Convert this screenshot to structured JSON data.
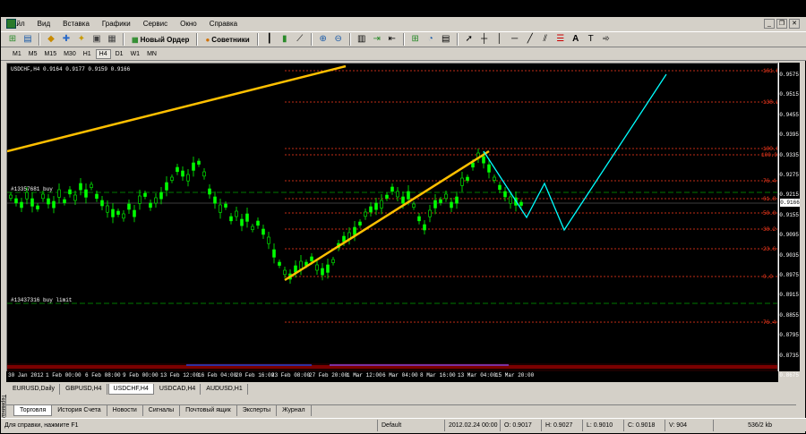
{
  "menu": {
    "items": [
      "Файл",
      "Вид",
      "Вставка",
      "Графики",
      "Сервис",
      "Окно",
      "Справка"
    ]
  },
  "toolbar": {
    "new_order_label": "Новый Ордер",
    "advisors_label": "Советники",
    "icons": [
      "new-chart-icon",
      "profiles-icon",
      "market-watch-icon",
      "data-window-icon",
      "navigator-icon",
      "terminal-icon",
      "tester-icon",
      "new-order-icon",
      "advisors-icon",
      "bar-chart-icon",
      "candle-chart-icon",
      "line-chart-icon",
      "zoom-in-icon",
      "zoom-out-icon",
      "tile-icon",
      "autoscroll-icon",
      "chart-shift-icon",
      "indicators-icon",
      "periods-icon",
      "templates-icon",
      "cursor-icon",
      "crosshair-icon",
      "vertical-line-icon",
      "horizontal-line-icon",
      "trendline-icon",
      "channel-icon",
      "fibonacci-icon",
      "text-icon",
      "label-icon",
      "arrows-icon"
    ]
  },
  "timeframes": [
    "M1",
    "M5",
    "M15",
    "M30",
    "H1",
    "H4",
    "D1",
    "W1",
    "MN"
  ],
  "active_timeframe": "H4",
  "chart": {
    "symbol_info": "USDCHF,H4  0.9164 0.9177 0.9159 0.9166",
    "order_buy_label": "#13357681 buy",
    "order_buy_limit_label": "#13437316 buy limit",
    "current_price": "0.9166",
    "price_ticks": [
      "0.9575",
      "0.9515",
      "0.9455",
      "0.9395",
      "0.9335",
      "0.9275",
      "0.9215",
      "0.9155",
      "0.9095",
      "0.9035",
      "0.8975",
      "0.8915",
      "0.8855",
      "0.8795",
      "0.8735",
      "0.8675"
    ],
    "time_ticks": [
      "30 Jan 2012",
      "1 Feb 00:00",
      "6 Feb 08:00",
      "9 Feb 00:00",
      "13 Feb 12:00",
      "16 Feb 04:00",
      "20 Feb 16:00",
      "23 Feb 08:00",
      "27 Feb 20:00",
      "1 Mar 12:00",
      "6 Mar 04:00",
      "8 Mar 16:00",
      "13 Mar 04:00",
      "15 Mar 20:00"
    ],
    "fib_levels": [
      "161.8",
      "138.2",
      "100.0",
      "100.0",
      "76.4",
      "61.8",
      "50.0",
      "38.2",
      "23.6",
      "0.0",
      "76.4"
    ],
    "colors": {
      "candle": "#00ff00",
      "trendline": "#ffc000",
      "projection": "#00ffff",
      "fib": "#ff3b1e",
      "order_line": "#00a000"
    }
  },
  "chart_tabs": [
    "EURUSD,Daily",
    "GBPUSD,H4",
    "USDCHF,H4",
    "USDCAD,H4",
    "AUDUSD,H1"
  ],
  "active_chart_tab": "USDCHF,H4",
  "terminal_tabs": [
    "Торговля",
    "История Счета",
    "Новости",
    "Сигналы",
    "Почтовый ящик",
    "Эксперты",
    "Журнал"
  ],
  "active_terminal_tab": "Торговля",
  "terminal_handle_label": "Терминал",
  "status": {
    "help": "Для справки, нажмите F1",
    "profile": "Default",
    "datetime": "2012.02.24 00:00",
    "open": "O: 0.9017",
    "high": "H: 0.9027",
    "low": "L: 0.9010",
    "close": "C: 0.9018",
    "volume": "V: 904",
    "traffic": "536/2 kb"
  }
}
